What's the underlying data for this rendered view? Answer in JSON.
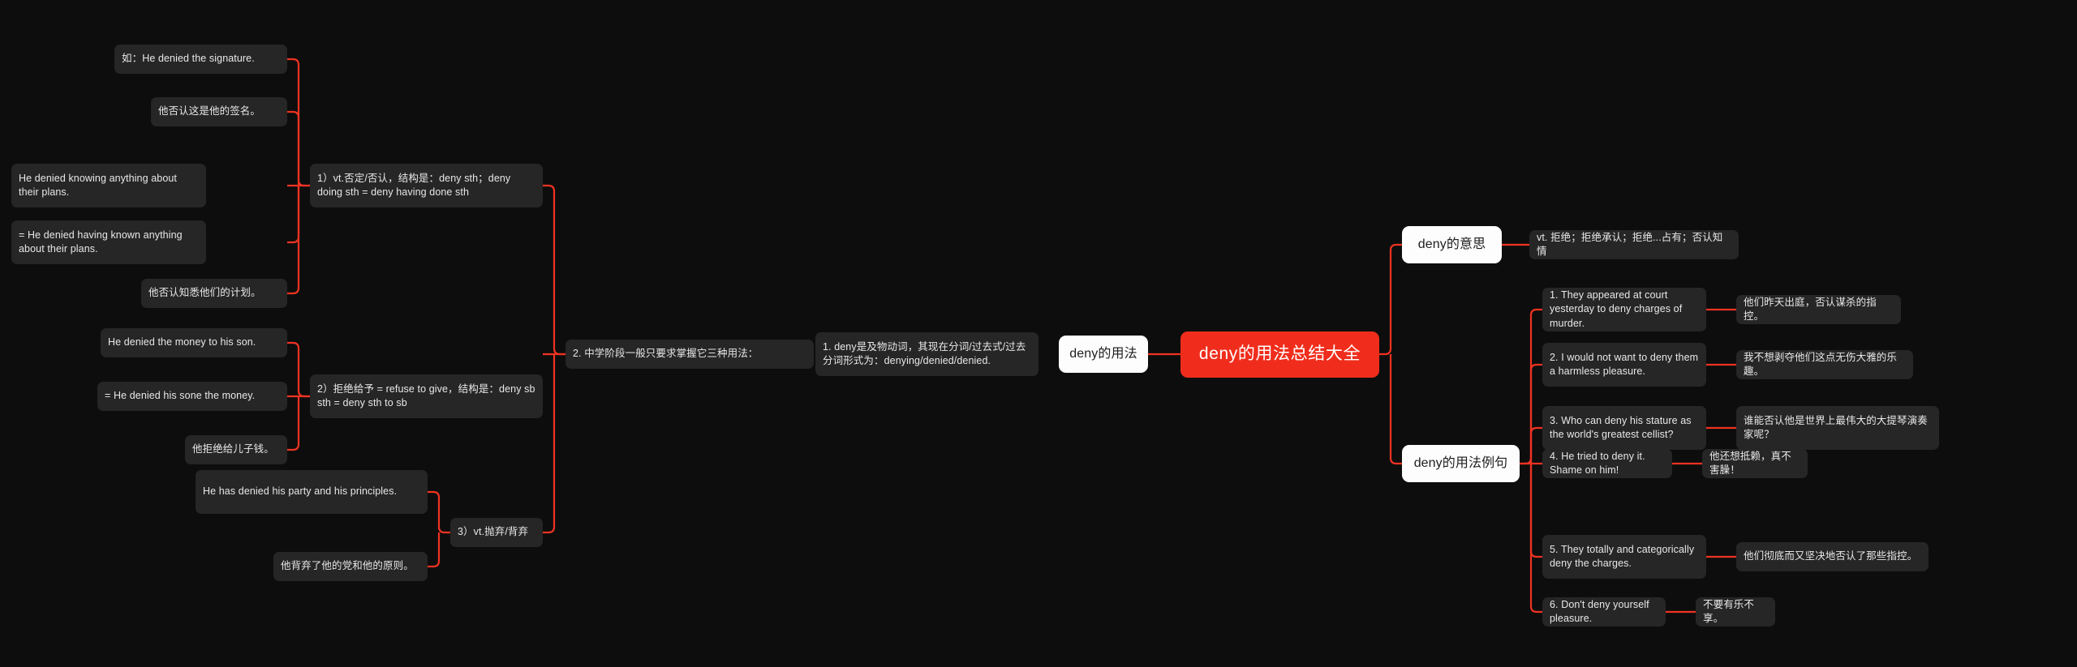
{
  "theme": {
    "background": "#0d0d0d",
    "accent": "#ee3322",
    "root_fill": "#f02d1c",
    "branch_fill": "#fdfdfd",
    "leaf_fill": "#262626",
    "leaf_text": "#e8e8e8"
  },
  "root": {
    "label": "deny的用法总结大全"
  },
  "branches": {
    "usage": {
      "label": "deny的用法"
    },
    "meaning": {
      "label": "deny的意思"
    },
    "examples": {
      "label": "deny的用法例句"
    }
  },
  "left": {
    "grammar_note": "1. deny是及物动词，其现在分词/过去式/过去分词形式为：denying/denied/denied.",
    "three_usages": "2. 中学阶段一般只要求掌握它三种用法：",
    "usage1": {
      "label": "1）vt.否定/否认，结构是：deny sth；deny doing sth = deny having done sth",
      "items": [
        "如：He denied the signature.",
        "他否认这是他的签名。",
        "He denied knowing anything about their plans.",
        "= He denied having known anything about their plans.",
        "他否认知悉他们的计划。"
      ]
    },
    "usage2": {
      "label": "2）拒绝给予 = refuse to give，结构是：deny sb sth = deny sth to sb",
      "items": [
        "He denied the money to his son.",
        "= He denied his sone the money.",
        "他拒绝给儿子钱。"
      ]
    },
    "usage3": {
      "label": "3）vt.抛弃/背弃",
      "items": [
        "He has denied his party and his principles.",
        "他背弃了他的党和他的原则。"
      ]
    }
  },
  "right": {
    "meaning_text": "vt. 拒绝；拒绝承认；拒绝...占有；否认知情",
    "examples": [
      {
        "en": "1. They appeared at court yesterday to deny charges of murder.",
        "zh": "他们昨天出庭，否认谋杀的指控。"
      },
      {
        "en": "2. I would not want to deny them a harmless pleasure.",
        "zh": "我不想剥夺他们这点无伤大雅的乐趣。"
      },
      {
        "en": "3. Who can deny his stature as the world's greatest cellist?",
        "zh": "谁能否认他是世界上最伟大的大提琴演奏家呢？"
      },
      {
        "en": "4. He tried to deny it. Shame on him!",
        "zh": "他还想抵赖，真不害臊！"
      },
      {
        "en": "5. They totally and categorically deny the charges.",
        "zh": "他们彻底而又坚决地否认了那些指控。"
      },
      {
        "en": "6. Don't deny yourself pleasure.",
        "zh": "不要有乐不享。"
      }
    ]
  }
}
